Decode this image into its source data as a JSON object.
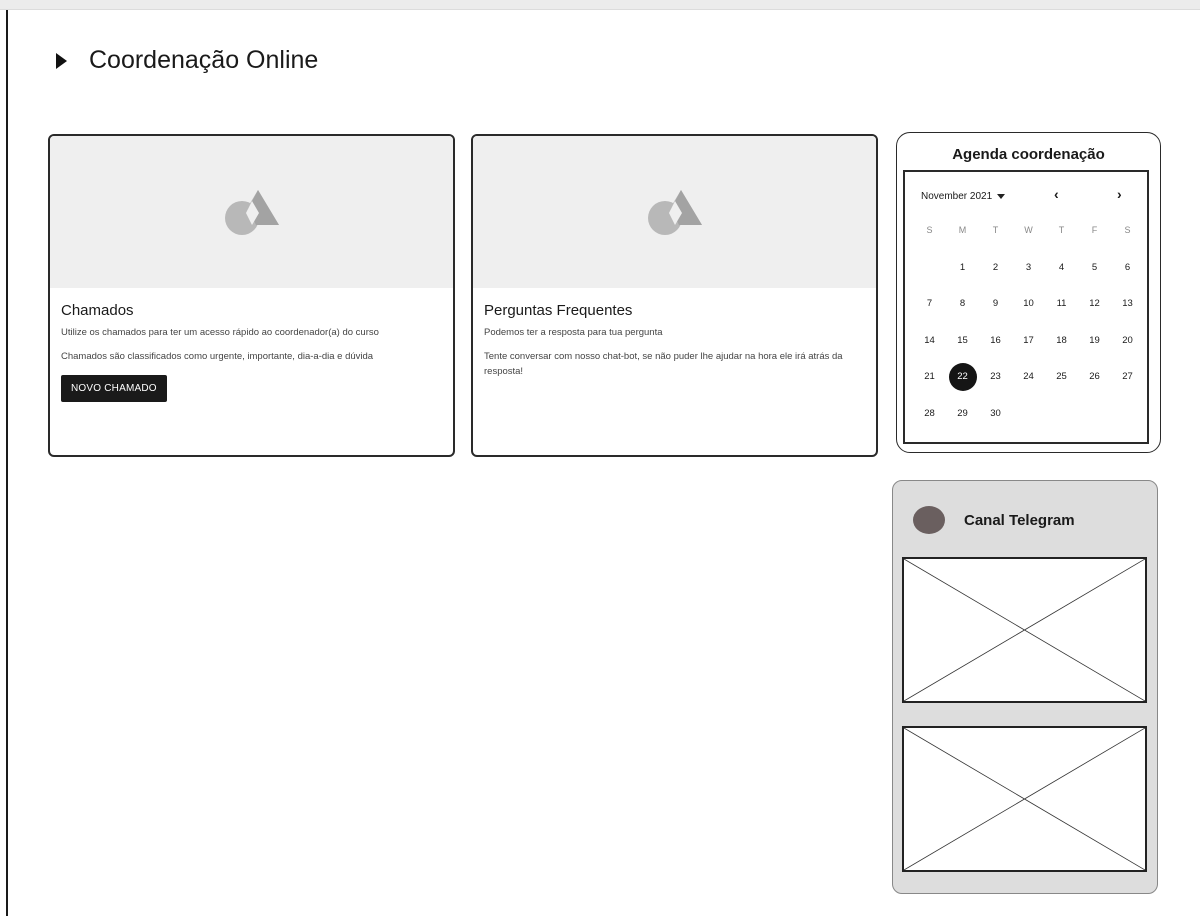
{
  "header": {
    "title": "Coordenação Online"
  },
  "cards": [
    {
      "title": "Chamados",
      "text1": "Utilize os chamados para ter um acesso rápido ao coordenador(a) do curso",
      "text2": "Chamados são classificados como urgente, importante, dia-a-dia e dúvida",
      "button": "NOVO CHAMADO"
    },
    {
      "title": "Perguntas Frequentes",
      "text1": "Podemos ter a resposta para tua pergunta",
      "text2": "Tente conversar com nosso chat-bot, se não puder lhe ajudar na hora ele irá atrás da resposta!"
    }
  ],
  "agenda": {
    "title": "Agenda coordenação",
    "month": "November 2021",
    "weekdays": [
      "S",
      "M",
      "T",
      "W",
      "T",
      "F",
      "S"
    ],
    "weeks": [
      [
        "",
        "1",
        "2",
        "3",
        "4",
        "5",
        "6"
      ],
      [
        "7",
        "8",
        "9",
        "10",
        "11",
        "12",
        "13"
      ],
      [
        "14",
        "15",
        "16",
        "17",
        "18",
        "19",
        "20"
      ],
      [
        "21",
        "22",
        "23",
        "24",
        "25",
        "26",
        "27"
      ],
      [
        "28",
        "29",
        "30",
        "",
        "",
        "",
        ""
      ]
    ],
    "selected": "22"
  },
  "telegram": {
    "title": "Canal Telegram"
  },
  "icons": {
    "header_caret": "caret-right-icon",
    "card_logo": "image-placeholder-icon",
    "month_dropdown": "chevron-down-icon",
    "prev": "chevron-left-icon",
    "next": "chevron-right-icon"
  }
}
